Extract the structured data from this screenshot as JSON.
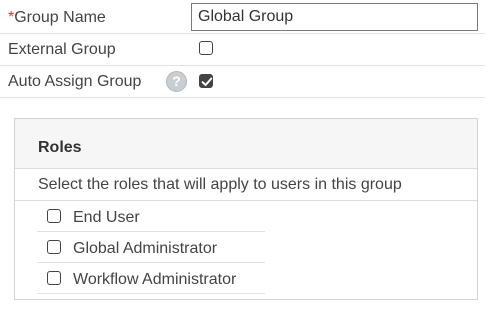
{
  "form": {
    "group_name": {
      "required_marker": "*",
      "label": "Group Name",
      "value": "Global Group"
    },
    "external_group": {
      "label": "External Group",
      "checked": false
    },
    "auto_assign_group": {
      "label": "Auto Assign Group",
      "help_glyph": "?",
      "checked": true
    }
  },
  "roles": {
    "title": "Roles",
    "description": "Select the roles that will apply to users in this group",
    "items": [
      {
        "label": "End User",
        "checked": false
      },
      {
        "label": "Global Administrator",
        "checked": false
      },
      {
        "label": "Workflow Administrator",
        "checked": false
      }
    ]
  },
  "colors": {
    "required": "#d03a2b",
    "checkbox_border": "#444444",
    "panel_bg": "#f6f6f6",
    "help_icon_bg": "#c9ced3"
  }
}
